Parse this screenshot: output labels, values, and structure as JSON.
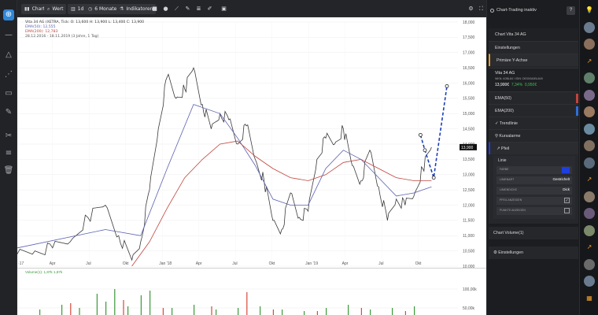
{
  "colors": {
    "accent_blue": "#2f87d8",
    "ema50": "#5a5fb0",
    "ema200": "#c0443c",
    "price": "#3a3a3a",
    "trend_dash": "#1d3fb8",
    "positive": "#3fbf5a",
    "volume_green": "#3a9a3a",
    "volume_red": "#d9483c",
    "highlight_orange": "#f0a02a"
  },
  "left_toolbar": {
    "icons": [
      "crosshair-icon",
      "horizontal-line-icon",
      "triangle-icon",
      "pattern-icon",
      "delete-icon",
      "pencil-icon",
      "tools-icon",
      "layers-icon",
      "trash-icon"
    ]
  },
  "top_toolbar": {
    "chart_label": "Chart",
    "wert_label": "Wert",
    "d1_label": "1d",
    "period_label": "6 Monate",
    "indicators_label": "Indikatoren"
  },
  "chart": {
    "legend_symbol": "Vita 34 AG (XETRA, Tick: O: 13,600  H: 13,900  L: 13,400  C: 13,900",
    "legend_ema50": "EMA(50): 12,555",
    "legend_ema200": "EMA(200): 12,783",
    "legend_range": "28.12.2016 - 18.11.2019  (3 Jahre, 1 Tag)",
    "price_label": "13,900",
    "left_cut_label": "·17"
  },
  "chart_data": {
    "type": "line",
    "title": "Vita 34 AG (XETRA)",
    "x_ticks": [
      "Apr",
      "Jul",
      "Okt",
      "Jan '18",
      "Apr",
      "Jul",
      "Okt",
      "Jan '19",
      "Apr",
      "Jul",
      "Okt"
    ],
    "ylim": [
      10.0,
      18.0
    ],
    "y_ticks": [
      "10,000",
      "10,500",
      "11,000",
      "11,500",
      "12,000",
      "12,500",
      "13,000",
      "13,500",
      "14,000",
      "14,500",
      "15,000",
      "15,500",
      "16,000",
      "16,500",
      "17,000",
      "17,500",
      "18,000"
    ],
    "series": [
      {
        "name": "Vita 34 AG",
        "x": [
          0.0,
          0.04,
          0.08,
          0.12,
          0.16,
          0.2,
          0.23,
          0.26,
          0.28,
          0.3,
          0.32,
          0.34,
          0.36,
          0.38,
          0.4,
          0.42,
          0.44,
          0.46,
          0.48,
          0.5,
          0.52,
          0.54,
          0.56,
          0.58,
          0.6,
          0.62,
          0.64,
          0.66,
          0.68,
          0.7,
          0.72,
          0.74,
          0.76,
          0.78,
          0.8,
          0.82,
          0.84,
          0.86,
          0.88,
          0.9,
          0.92,
          0.94
        ],
        "y": [
          10.4,
          10.5,
          10.6,
          10.8,
          11.6,
          12.0,
          11.0,
          10.2,
          10.8,
          12.5,
          14.5,
          16.2,
          15.5,
          15.8,
          16.5,
          15.3,
          14.5,
          15.0,
          14.8,
          14.0,
          14.6,
          13.5,
          12.8,
          11.5,
          11.2,
          12.4,
          11.6,
          11.8,
          13.5,
          14.2,
          14.0,
          14.5,
          13.3,
          12.8,
          13.8,
          12.6,
          11.5,
          12.2,
          12.0,
          12.3,
          13.2,
          13.9
        ]
      },
      {
        "name": "EMA(50)",
        "x": [
          0.0,
          0.2,
          0.28,
          0.34,
          0.4,
          0.46,
          0.5,
          0.54,
          0.58,
          0.62,
          0.66,
          0.7,
          0.74,
          0.78,
          0.82,
          0.86,
          0.9,
          0.94
        ],
        "y": [
          10.6,
          11.2,
          11.0,
          13.2,
          15.3,
          15.0,
          14.2,
          13.3,
          12.2,
          12.0,
          12.0,
          13.2,
          13.8,
          13.5,
          12.9,
          12.3,
          12.4,
          12.6
        ]
      },
      {
        "name": "EMA(200)",
        "x": [
          0.26,
          0.3,
          0.34,
          0.38,
          0.42,
          0.46,
          0.5,
          0.54,
          0.58,
          0.62,
          0.66,
          0.7,
          0.74,
          0.78,
          0.82,
          0.86,
          0.9,
          0.94
        ],
        "y": [
          10.0,
          10.8,
          11.9,
          12.9,
          13.5,
          14.0,
          14.1,
          13.6,
          13.2,
          12.9,
          12.8,
          13.0,
          13.4,
          13.5,
          13.2,
          12.9,
          12.8,
          12.8
        ]
      }
    ],
    "trendline": {
      "x": [
        0.915,
        0.925,
        0.945,
        0.975
      ],
      "y": [
        14.3,
        13.8,
        12.9,
        15.9
      ]
    },
    "volume": {
      "legend": "Volume(1): 1,87k  1,87k",
      "y_ticks": [
        "100,00k",
        "50,00k"
      ],
      "green_x": [
        0.05,
        0.1,
        0.14,
        0.18,
        0.2,
        0.22,
        0.25,
        0.28,
        0.3,
        0.35,
        0.4,
        0.45,
        0.5,
        0.55,
        0.6,
        0.65,
        0.7,
        0.75,
        0.8,
        0.85,
        0.9
      ],
      "green_h": [
        8,
        14,
        10,
        28,
        18,
        34,
        12,
        26,
        32,
        10,
        14,
        8,
        10,
        12,
        8,
        6,
        10,
        14,
        8,
        10,
        12
      ],
      "red_x": [
        0.12,
        0.24,
        0.33,
        0.44,
        0.52,
        0.58,
        0.68,
        0.78,
        0.88
      ],
      "red_h": [
        16,
        20,
        10,
        12,
        30,
        8,
        6,
        10,
        6
      ]
    }
  },
  "right_panel": {
    "title": "Chart-Trading inaktiv",
    "help": "?",
    "section_title": "Chart Vita 34 AG",
    "rows": {
      "settings": "Einstellungen",
      "primary_axis": "Primäre Y-Achse"
    },
    "stock": {
      "name": "Vita 34 AG",
      "wkn": "WKN: A0BL84 / ISIN: DE000A0BL849",
      "price": "13,900€",
      "change_pct": "7,34%",
      "change_abs": "0,950€"
    },
    "ind1": "EMA(50)",
    "ind2": "EMA(200)",
    "trendlinie": "Trendlinie",
    "kursalarme": "Kursalarme",
    "pfeil": "Pfeil",
    "linie": {
      "title": "Linie",
      "farbe": "FARBE",
      "linienart": "LINIENART",
      "linienart_value": "Gestrichelt",
      "liniendicke": "LINIENDICKE",
      "liniendicke_value": "Dick",
      "pfeil_anzeigen": "PFEIL ANZEIGEN",
      "punkte_anzeigen": "PUNKTE ANZEIGEN",
      "swatch_color": "#1e3fe0"
    },
    "volume_section": "Chart Volume(1)",
    "volume_settings": "Einstellungen"
  },
  "far_right": {
    "items": [
      "lightbulb-icon",
      "avatar",
      "avatar",
      "chart-up-icon",
      "avatar",
      "avatar",
      "avatar",
      "avatar",
      "avatar",
      "avatar",
      "chart-up-icon",
      "avatar",
      "avatar",
      "avatar",
      "chart-up-icon",
      "avatar",
      "avatar",
      "grid-icon"
    ]
  }
}
